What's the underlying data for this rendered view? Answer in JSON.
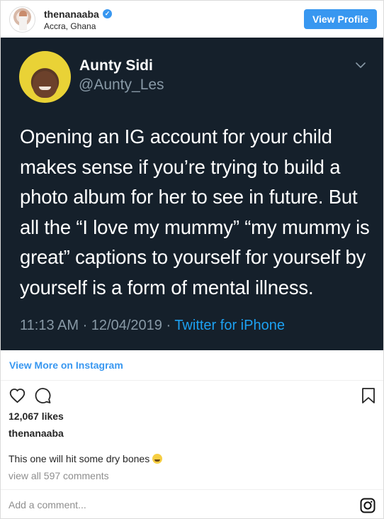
{
  "header": {
    "username": "thenanaaba",
    "verified_icon": "verified-badge-icon",
    "location": "Accra, Ghana",
    "view_profile_label": "View Profile"
  },
  "tweet": {
    "name": "Aunty Sidi",
    "handle": "@Aunty_Les",
    "text": "Opening an IG account for your child makes sense if you’re trying to build a photo album for her to see in future. But all the “I love my mummy” “my mummy is great” captions to yourself for yourself by yourself is a form of mental illness.",
    "timestamp": "11:13 AM · 12/04/2019 · ",
    "source": "Twitter for iPhone"
  },
  "post": {
    "view_more_label": "View More on Instagram",
    "likes": "12,067 likes",
    "owner": "thenanaaba",
    "caption": "This one will hit some dry bones",
    "caption_emoji": "😂",
    "comments_link": "view all 597 comments",
    "comment_placeholder": "Add a comment..."
  },
  "icons": {
    "heart": "heart-icon",
    "comment": "comment-icon",
    "bookmark": "bookmark-icon",
    "instagram": "instagram-icon"
  },
  "colors": {
    "accent": "#3897f0",
    "twitter_dark_bg": "#15202b",
    "twitter_link": "#1da1f2"
  }
}
